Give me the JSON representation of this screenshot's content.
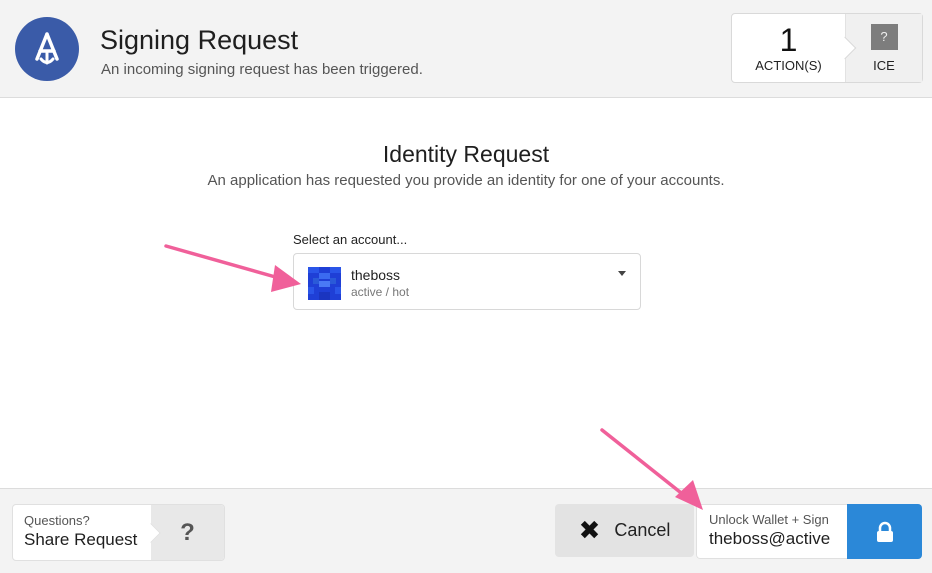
{
  "header": {
    "title": "Signing Request",
    "subtitle": "An incoming signing request has been triggered.",
    "actions_count": "1",
    "actions_label": "ACTION(S)",
    "chain_icon": "?",
    "chain_label": "ICE"
  },
  "main": {
    "title": "Identity Request",
    "subtitle": "An application has requested you provide an identity for one of your accounts.",
    "select_label": "Select an account...",
    "account": {
      "name": "theboss",
      "permission": "active / hot"
    }
  },
  "footer": {
    "questions_label": "Questions?",
    "share_label": "Share Request",
    "help_icon": "?",
    "cancel_label": "Cancel",
    "unlock_label": "Unlock Wallet + Sign",
    "sign_account": "theboss@active"
  },
  "colors": {
    "brand": "#3a5ba8",
    "primary_button": "#2b88d8",
    "annotation_arrow": "#f0609a"
  }
}
